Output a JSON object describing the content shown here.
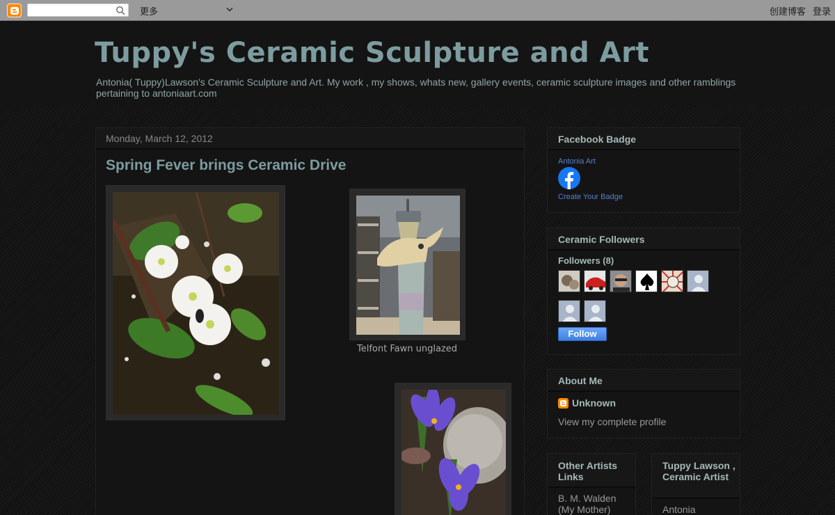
{
  "navbar": {
    "search_value": "",
    "more_label": "更多",
    "create_blog": "创建博客",
    "sign_in": "登录"
  },
  "header": {
    "title": "Tuppy's Ceramic Sculpture and Art",
    "description": "Antonia( Tuppy)Lawson's Ceramic Sculpture and Art. My work , my shows, whats new, gallery events, ceramic sculpture images and other ramblings pertaining to antoniaart.com"
  },
  "post": {
    "date": "Monday, March 12, 2012",
    "title": "Spring Fever brings Ceramic Drive",
    "caption_fawn": "Telfont Fawn unglazed"
  },
  "sidebar": {
    "facebook": {
      "title": "Facebook Badge",
      "name_link": "Antonia Art",
      "create_link": "Create Your Badge"
    },
    "followers": {
      "title": "Ceramic Followers",
      "count_label": "Followers (8)",
      "follow_button": "Follow"
    },
    "about": {
      "title": "About Me",
      "profile_name": "Unknown",
      "profile_link": "View my complete profile"
    },
    "other_links": {
      "title": "Other Artists Links",
      "first_item": "B. M. Walden (My Mother)"
    },
    "tuppy": {
      "title": "Tuppy Lawson , Ceramic Artist",
      "first_item": "Antonia"
    }
  },
  "colors": {
    "title": "#7d9c9f",
    "link": "#5a7fd0",
    "background": "#141414"
  }
}
